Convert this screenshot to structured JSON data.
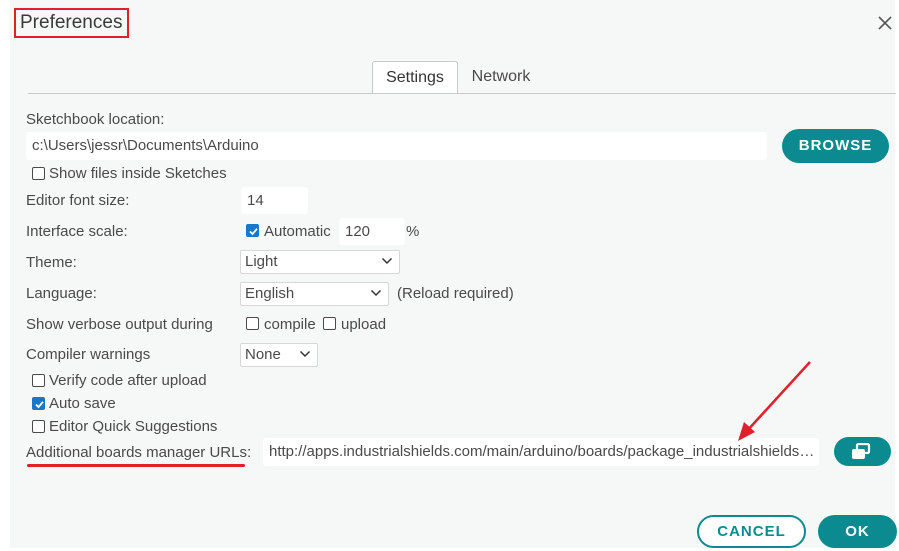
{
  "dialog": {
    "title": "Preferences",
    "close_icon": "close-icon"
  },
  "tabs": [
    {
      "label": "Settings",
      "active": true
    },
    {
      "label": "Network",
      "active": false
    }
  ],
  "sketchbook": {
    "label": "Sketchbook location:",
    "value": "c:\\Users\\jessr\\Documents\\Arduino",
    "browse_label": "BROWSE",
    "show_files_label": "Show files inside Sketches",
    "show_files_checked": false
  },
  "font_size": {
    "label": "Editor font size:",
    "value": "14"
  },
  "interface_scale": {
    "label": "Interface scale:",
    "automatic_label": "Automatic",
    "automatic_checked": true,
    "value": "120",
    "unit": "%"
  },
  "theme": {
    "label": "Theme:",
    "selected": "Light"
  },
  "language": {
    "label": "Language:",
    "selected": "English",
    "note": "(Reload required)"
  },
  "verbose": {
    "label": "Show verbose output during",
    "compile_label": "compile",
    "compile_checked": false,
    "upload_label": "upload",
    "upload_checked": false
  },
  "compiler_warnings": {
    "label": "Compiler warnings",
    "selected": "None"
  },
  "options": [
    {
      "label": "Verify code after upload",
      "checked": false
    },
    {
      "label": "Auto save",
      "checked": true
    },
    {
      "label": "Editor Quick Suggestions",
      "checked": false
    }
  ],
  "boards_urls": {
    "label": "Additional boards manager URLs:",
    "value": "http://apps.industrialshields.com/main/arduino/boards/package_industrialshields_index.json"
  },
  "footer": {
    "cancel_label": "CANCEL",
    "ok_label": "OK"
  },
  "colors": {
    "accent": "#0b8a8f",
    "checkbox": "#1877c9",
    "annotation": "#e0202a"
  }
}
